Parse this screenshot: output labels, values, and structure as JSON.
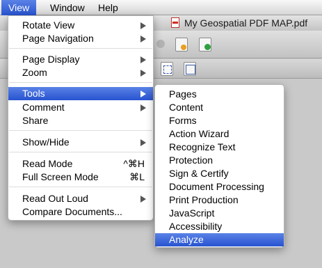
{
  "menubar": {
    "items": [
      {
        "label": "View",
        "active": true
      },
      {
        "label": "Window",
        "active": false
      },
      {
        "label": "Help",
        "active": false
      }
    ]
  },
  "window": {
    "document_title": "My Geospatial PDF MAP.pdf"
  },
  "view_menu": {
    "items": [
      {
        "label": "Rotate View",
        "submenu": true
      },
      {
        "label": "Page Navigation",
        "submenu": true
      },
      {
        "label": "Page Display",
        "submenu": true
      },
      {
        "label": "Zoom",
        "submenu": true
      },
      {
        "label": "Tools",
        "submenu": true,
        "highlighted": true
      },
      {
        "label": "Comment",
        "submenu": true
      },
      {
        "label": "Share",
        "submenu": false
      },
      {
        "label": "Show/Hide",
        "submenu": true
      },
      {
        "label": "Read Mode",
        "shortcut": "^⌘H"
      },
      {
        "label": "Full Screen Mode",
        "shortcut": "⌘L"
      },
      {
        "label": "Read Out Loud",
        "submenu": true
      },
      {
        "label": "Compare Documents..."
      }
    ]
  },
  "tools_submenu": {
    "items": [
      {
        "label": "Pages"
      },
      {
        "label": "Content"
      },
      {
        "label": "Forms"
      },
      {
        "label": "Action Wizard"
      },
      {
        "label": "Recognize Text"
      },
      {
        "label": "Protection"
      },
      {
        "label": "Sign & Certify"
      },
      {
        "label": "Document Processing"
      },
      {
        "label": "Print Production"
      },
      {
        "label": "JavaScript"
      },
      {
        "label": "Accessibility"
      },
      {
        "label": "Analyze",
        "highlighted": true
      }
    ]
  },
  "colors": {
    "highlight": "#2f5ad6",
    "menu_background": "#ffffff"
  }
}
